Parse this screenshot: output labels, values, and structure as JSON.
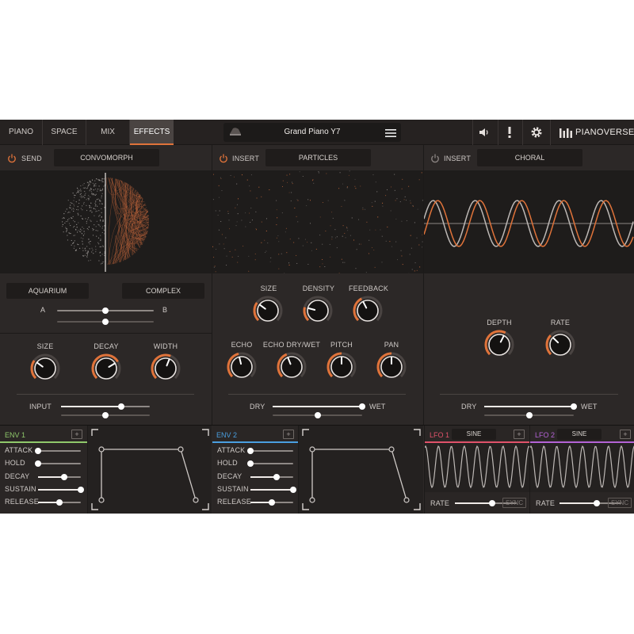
{
  "topbar": {
    "tabs": [
      {
        "label": "PIANO",
        "active": false
      },
      {
        "label": "SPACE",
        "active": false
      },
      {
        "label": "MIX",
        "active": false
      },
      {
        "label": "EFFECTS",
        "active": true
      }
    ],
    "preset_name": "Grand Piano Y7",
    "brand": "PIANOVERSE",
    "icons": [
      "speaker-icon",
      "alert-icon",
      "gear-icon",
      "pianoverse-logo-icon"
    ]
  },
  "panels": {
    "send": {
      "slot": "SEND",
      "effect": "CONVOMORPH",
      "source_a": "AQUARIUM",
      "source_b": "COMPLEX",
      "a_label": "A",
      "b_label": "B",
      "morph": 0.5,
      "morph2": 0.5,
      "knobs": [
        {
          "label": "SIZE",
          "value": 0.3
        },
        {
          "label": "DECAY",
          "value": 0.72
        },
        {
          "label": "WIDTH",
          "value": 0.58
        }
      ],
      "input_label": "INPUT",
      "input_value": 0.68,
      "input_value2": 0.5
    },
    "insert1": {
      "slot": "INSERT",
      "effect": "PARTICLES",
      "knobs_top": [
        {
          "label": "SIZE",
          "value": 0.3
        },
        {
          "label": "DENSITY",
          "value": 0.22
        },
        {
          "label": "FEEDBACK",
          "value": 0.4
        }
      ],
      "knobs_bottom": [
        {
          "label": "ECHO",
          "value": 0.45
        },
        {
          "label": "ECHO DRY/WET",
          "value": 0.42
        },
        {
          "label": "PITCH",
          "value": 0.5
        },
        {
          "label": "PAN",
          "value": 0.5
        }
      ],
      "dry_label": "DRY",
      "wet_label": "WET",
      "drywet": 1.0,
      "drywet2": 0.5
    },
    "insert2": {
      "slot": "INSERT",
      "effect": "CHORAL",
      "knobs": [
        {
          "label": "DEPTH",
          "value": 0.6
        },
        {
          "label": "RATE",
          "value": 0.33
        }
      ],
      "dry_label": "DRY",
      "wet_label": "WET",
      "drywet": 1.0,
      "drywet2": 0.5
    }
  },
  "colors": {
    "accent": "#e0733a",
    "env1": "#8fc96b",
    "env2": "#4a9fe0",
    "lfo1": "#e0526a",
    "lfo2": "#b463d6"
  },
  "modulators": {
    "env1": {
      "title": "ENV 1",
      "params": [
        {
          "label": "ATTACK",
          "value": 0.0
        },
        {
          "label": "HOLD",
          "value": 0.0
        },
        {
          "label": "DECAY",
          "value": 0.62
        },
        {
          "label": "SUSTAIN",
          "value": 1.0
        },
        {
          "label": "RELEASE",
          "value": 0.5
        }
      ]
    },
    "env2": {
      "title": "ENV 2",
      "params": [
        {
          "label": "ATTACK",
          "value": 0.0
        },
        {
          "label": "HOLD",
          "value": 0.0
        },
        {
          "label": "DECAY",
          "value": 0.62
        },
        {
          "label": "SUSTAIN",
          "value": 1.0
        },
        {
          "label": "RELEASE",
          "value": 0.5
        }
      ]
    },
    "lfo1": {
      "title": "LFO 1",
      "shape": "SINE",
      "rate_label": "RATE",
      "rate": 0.6,
      "sync": "SYNC"
    },
    "lfo2": {
      "title": "LFO 2",
      "shape": "SINE",
      "rate_label": "RATE",
      "rate": 0.6,
      "sync": "SYNC"
    }
  },
  "plus_label": "+"
}
